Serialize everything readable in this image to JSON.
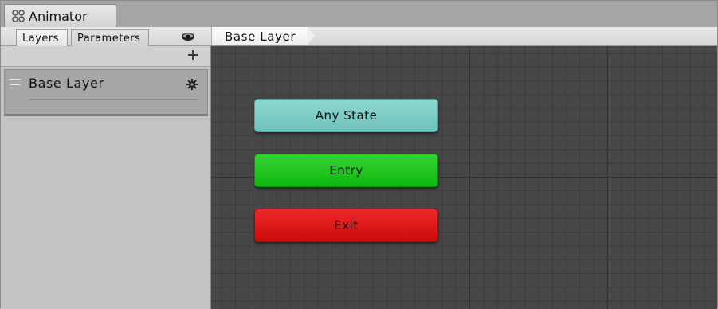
{
  "window": {
    "tab_title": "Animator",
    "tab_icon": "animator-icon"
  },
  "toolbar": {
    "tabs": [
      {
        "label": "Layers",
        "selected": true
      },
      {
        "label": "Parameters",
        "selected": false
      }
    ],
    "eye_icon": "eye-icon",
    "breadcrumb": [
      "Base Layer"
    ]
  },
  "layers_panel": {
    "add_icon": "plus-icon",
    "layers": [
      {
        "name": "Base Layer",
        "settings_icon": "gear-icon"
      }
    ]
  },
  "graph": {
    "nodes": [
      {
        "label": "Any State",
        "color": "#79c9c1"
      },
      {
        "label": "Entry",
        "color": "#1ec21e"
      },
      {
        "label": "Exit",
        "color": "#dd1a1a"
      }
    ],
    "background_color": "#474747"
  }
}
